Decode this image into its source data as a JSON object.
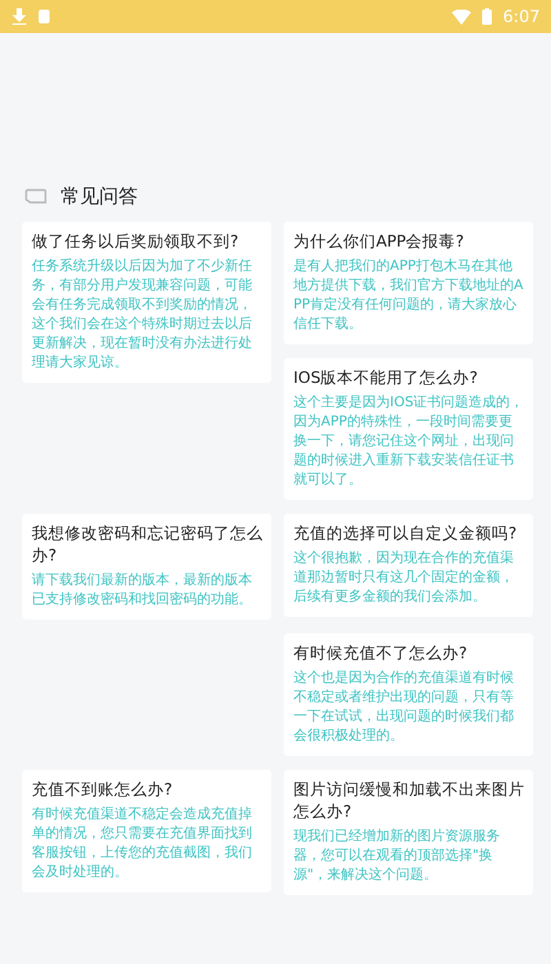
{
  "status_bar": {
    "time": "6:07"
  },
  "section": {
    "title": "常见问答"
  },
  "faqs": [
    {
      "question": "做了任务以后奖励领取不到?",
      "answer": "任务系统升级以后因为加了不少新任务，有部分用户发现兼容问题，可能会有任务完成领取不到奖励的情况，这个我们会在这个特殊时期过去以后更新解决，现在暂时没有办法进行处理请大家见谅。"
    },
    {
      "question": "为什么你们APP会报毒?",
      "answer": "是有人把我们的APP打包木马在其他地方提供下载，我们官方下载地址的APP肯定没有任何问题的，请大家放心信任下载。"
    },
    {
      "question": "IOS版本不能用了怎么办?",
      "answer": "这个主要是因为IOS证书问题造成的，因为APP的特殊性，一段时间需要更换一下，请您记住这个网址，出现问题的时候进入重新下载安装信任证书就可以了。"
    },
    {
      "question": "我想修改密码和忘记密码了怎么办?",
      "answer": "请下载我们最新的版本，最新的版本已支持修改密码和找回密码的功能。"
    },
    {
      "question": "充值的选择可以自定义金额吗?",
      "answer": "这个很抱歉，因为现在合作的充值渠道那边暂时只有这几个固定的金额，后续有更多金额的我们会添加。"
    },
    {
      "question": "有时候充值不了怎么办?",
      "answer": "这个也是因为合作的充值渠道有时候不稳定或者维护出现的问题，只有等一下在试试，出现问题的时候我们都会很积极处理的。"
    },
    {
      "question": "充值不到账怎么办?",
      "answer": "有时候充值渠道不稳定会造成充值掉单的情况，您只需要在充值界面找到客服按钮，上传您的充值截图，我们会及时处理的。"
    },
    {
      "question": "图片访问缓慢和加载不出来图片怎么办?",
      "answer": "现我们已经增加新的图片资源服务器，您可以在观看的顶部选择\"换源\"，来解决这个问题。"
    }
  ]
}
